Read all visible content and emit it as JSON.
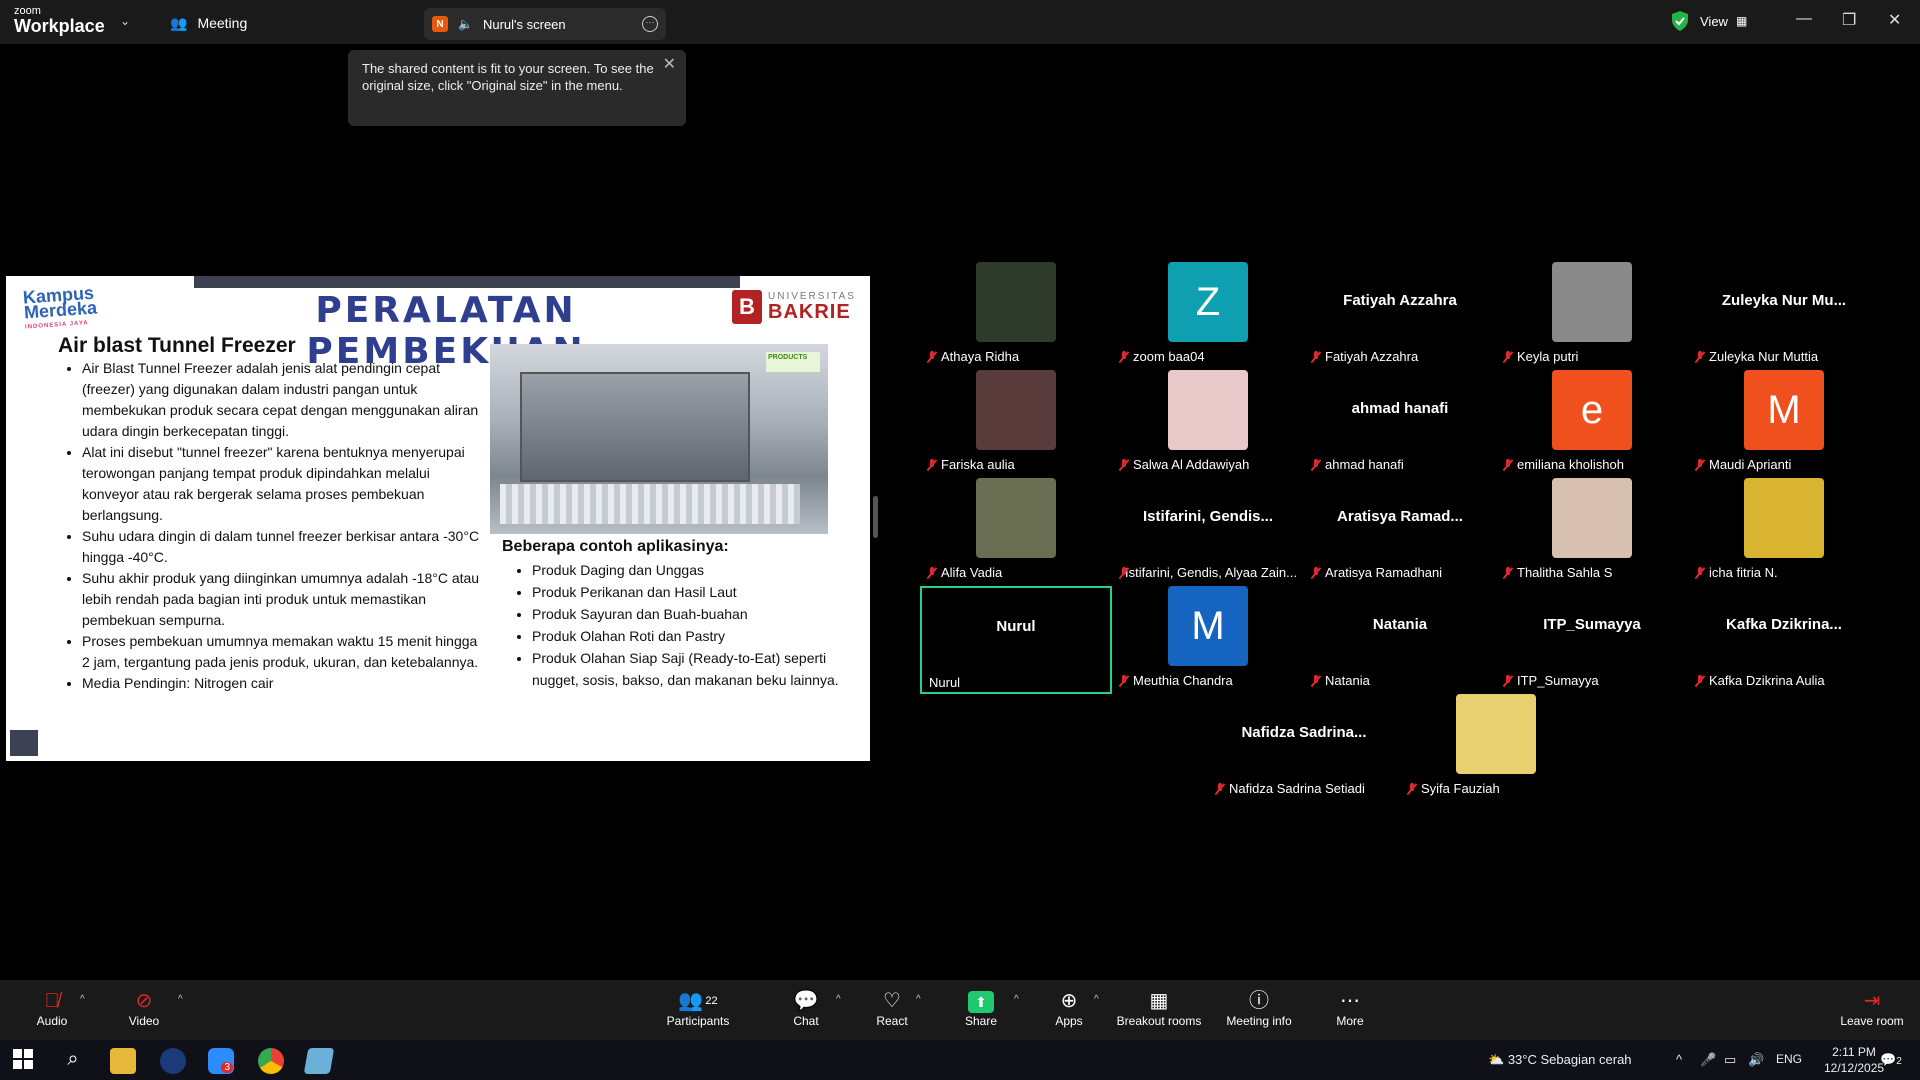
{
  "app": {
    "brand_top": "zoom",
    "brand_bottom": "Workplace",
    "meeting_label": "Meeting"
  },
  "screen_tab": {
    "badge": "N",
    "label": "Nurul's screen"
  },
  "window": {
    "view_label": "View"
  },
  "tooltip": {
    "text": "The shared content is fit to your screen. To see the original size, click \"Original size\" in the menu."
  },
  "slide": {
    "logo_km_1": "Kampus",
    "logo_km_2": "Merdeka",
    "logo_km_sub": "INDONESIA JAYA",
    "title": "PERALATAN PEMBEKUAN",
    "ub_logo": "B",
    "ub_line1": "UNIVERSITAS",
    "ub_line2": "BAKRIE",
    "heading": "Air blast Tunnel Freezer",
    "photo_tag": "PRODUCTS",
    "bullets": [
      "Air Blast Tunnel Freezer adalah jenis alat pendingin cepat (freezer) yang digunakan dalam industri pangan untuk membekukan produk secara cepat dengan menggunakan aliran udara dingin berkecepatan tinggi.",
      "Alat ini disebut \"tunnel freezer\" karena bentuknya menyerupai terowongan panjang tempat produk dipindahkan melalui konveyor atau rak bergerak selama proses pembekuan berlangsung.",
      "Suhu udara dingin di dalam tunnel freezer berkisar antara -30°C hingga -40°C.",
      "Suhu akhir produk yang diinginkan umumnya adalah -18°C atau lebih rendah pada bagian inti produk untuk memastikan pembekuan sempurna.",
      "Proses pembekuan umumnya memakan waktu 15 menit hingga 2 jam, tergantung pada jenis produk, ukuran, dan ketebalannya.",
      "Media Pendingin: Nitrogen cair"
    ],
    "apps_heading": "Beberapa contoh aplikasinya:",
    "apps": [
      "Produk Daging dan Unggas",
      "Produk Perikanan dan Hasil Laut",
      "Produk Sayuran dan Buah-buahan",
      "Produk Olahan Roti dan Pastry",
      "Produk Olahan Siap Saji (Ready-to-Eat) seperti nugget, sosis, bakso, dan makanan beku lainnya."
    ]
  },
  "participants": [
    {
      "label": "Athaya Ridha",
      "big": "",
      "avatar": "",
      "color": "#2f3b2a"
    },
    {
      "label": "zoom baa04",
      "big": "",
      "avatar": "Z",
      "color": "#0e9fb0"
    },
    {
      "label": "Fatiyah Azzahra",
      "big": "Fatiyah Azzahra",
      "avatar": "",
      "color": ""
    },
    {
      "label": "Keyla putri",
      "big": "",
      "avatar": "",
      "color": "#8a8a8a"
    },
    {
      "label": "Zuleyka Nur Muttia",
      "big": "Zuleyka Nur Mu...",
      "avatar": "",
      "color": ""
    },
    {
      "label": "Fariska aulia",
      "big": "",
      "avatar": "",
      "color": "#5a3b3b"
    },
    {
      "label": "Salwa Al Addawiyah",
      "big": "",
      "avatar": "",
      "color": "#e8c8c8"
    },
    {
      "label": "ahmad hanafi",
      "big": "ahmad hanafi",
      "avatar": "",
      "color": ""
    },
    {
      "label": "emiliana kholishoh",
      "big": "",
      "avatar": "e",
      "color": "#f0501e"
    },
    {
      "label": "Maudi Aprianti",
      "big": "",
      "avatar": "M",
      "color": "#f0501e"
    },
    {
      "label": "Alifa Vadia",
      "big": "",
      "avatar": "",
      "color": "#6a6e52"
    },
    {
      "label": "Istifarini, Gendis, Alyaa Zain...",
      "big": "Istifarini,  Gendis...",
      "avatar": "",
      "color": ""
    },
    {
      "label": "Aratisya Ramadhani",
      "big": "Aratisya  Ramad...",
      "avatar": "",
      "color": ""
    },
    {
      "label": "Thalitha Sahla S",
      "big": "",
      "avatar": "",
      "color": "#d8c0b0"
    },
    {
      "label": "icha fitria N.",
      "big": "",
      "avatar": "",
      "color": "#d8b430"
    },
    {
      "label": "Nurul",
      "big": "Nurul",
      "avatar": "",
      "color": ""
    },
    {
      "label": "Meuthia Chandra",
      "big": "",
      "avatar": "M",
      "color": "#1565c0"
    },
    {
      "label": "Natania",
      "big": "Natania",
      "avatar": "",
      "color": ""
    },
    {
      "label": "ITP_Sumayya",
      "big": "ITP_Sumayya",
      "avatar": "",
      "color": ""
    },
    {
      "label": "Kafka Dzikrina Aulia",
      "big": "Kafka  Dzikrina...",
      "avatar": "",
      "color": ""
    },
    {
      "label": "Nafidza Sadrina Setiadi",
      "big": "Nafidza  Sadrina...",
      "avatar": "",
      "color": ""
    },
    {
      "label": "Syifa Fauziah",
      "big": "",
      "avatar": "",
      "color": "#e8d070"
    }
  ],
  "toolbar": {
    "audio": "Audio",
    "video": "Video",
    "participants": "Participants",
    "participants_count": "22",
    "chat": "Chat",
    "react": "React",
    "share": "Share",
    "apps": "Apps",
    "breakout": "Breakout rooms",
    "meeting_info": "Meeting info",
    "more": "More",
    "leave": "Leave room"
  },
  "taskbar": {
    "weather": "33°C  Sebagian cerah",
    "lang": "ENG",
    "time": "2:11 PM",
    "date": "12/12/2025",
    "zoom_badge": "3",
    "notif_count": "2"
  },
  "colors": {
    "active_border": "#23d18b",
    "muted": "#e02828",
    "share": "#1fc96f",
    "title_blue": "#2e3f8f",
    "bakrie_red": "#b22222"
  }
}
